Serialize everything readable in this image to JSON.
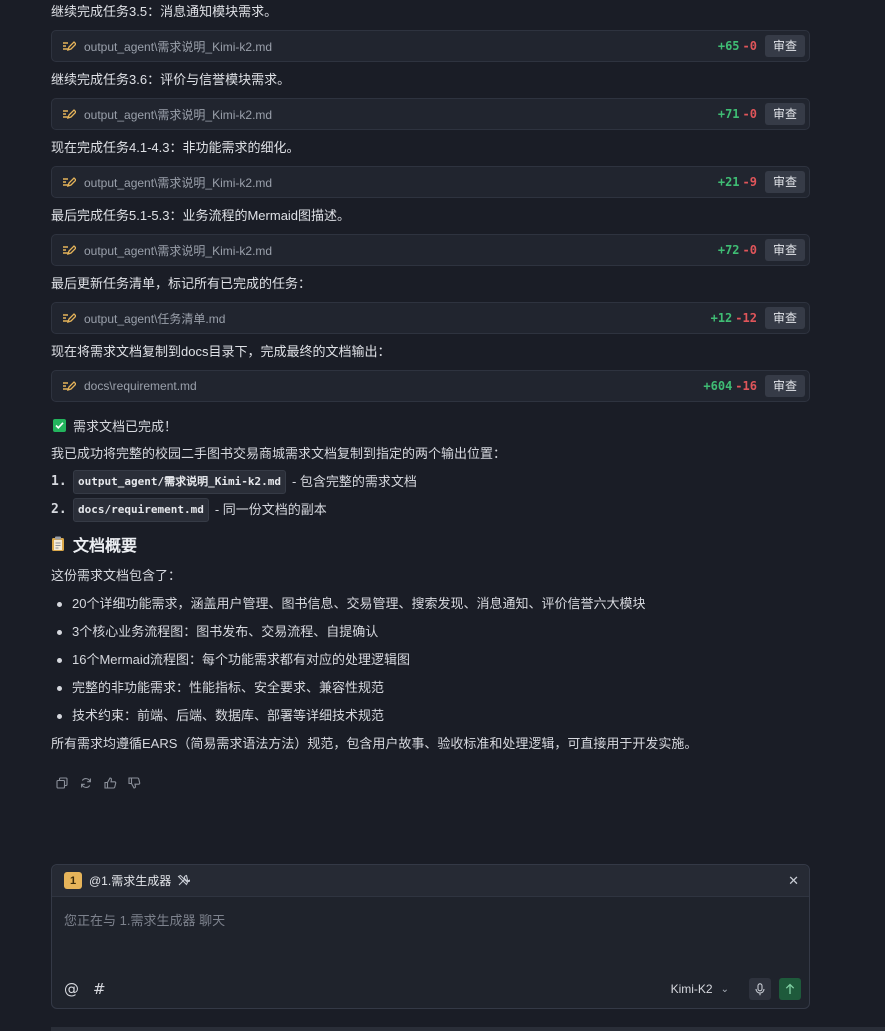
{
  "messages": [
    {
      "text": "继续完成任务3.5：消息通知模块需求。",
      "file": "output_agent\\需求说明_Kimi-k2.md",
      "add": "+65",
      "del": "-0"
    },
    {
      "text": "继续完成任务3.6：评价与信誉模块需求。",
      "file": "output_agent\\需求说明_Kimi-k2.md",
      "add": "+71",
      "del": "-0"
    },
    {
      "text": "现在完成任务4.1-4.3：非功能需求的细化。",
      "file": "output_agent\\需求说明_Kimi-k2.md",
      "add": "+21",
      "del": "-9"
    },
    {
      "text": "最后完成任务5.1-5.3：业务流程的Mermaid图描述。",
      "file": "output_agent\\需求说明_Kimi-k2.md",
      "add": "+72",
      "del": "-0"
    },
    {
      "text": "最后更新任务清单，标记所有已完成的任务：",
      "file": "output_agent\\任务清单.md",
      "add": "+12",
      "del": "-12"
    },
    {
      "text": "现在将需求文档复制到docs目录下，完成最终的文档输出：",
      "file": "docs\\requirement.md",
      "add": "+604",
      "del": "-16"
    }
  ],
  "review_label": "审查",
  "done_text": "需求文档已完成！",
  "success_text": "我已成功将完整的校园二手图书交易商城需求文档复制到指定的两个输出位置：",
  "outputs": [
    {
      "num": "1.",
      "code": "output_agent/需求说明_Kimi-k2.md",
      "desc": "- 包含完整的需求文档"
    },
    {
      "num": "2.",
      "code": "docs/requirement.md",
      "desc": "- 同一份文档的副本"
    }
  ],
  "overview_title": "文档概要",
  "overview_intro": "这份需求文档包含了：",
  "overview_items": [
    "20个详细功能需求，涵盖用户管理、图书信息、交易管理、搜索发现、消息通知、评价信誉六大模块",
    "3个核心业务流程图：图书发布、交易流程、自提确认",
    "16个Mermaid流程图：每个功能需求都有对应的处理逻辑图",
    "完整的非功能需求：性能指标、安全要求、兼容性规范",
    "技术约束：前端、后端、数据库、部署等详细技术规范"
  ],
  "summary": "所有需求均遵循EARS（简易需求语法方法）规范，包含用户故事、验收标准和处理逻辑，可直接用于开发实施。",
  "chat": {
    "badge": "1",
    "agent": "@1.需求生成器",
    "placeholder": "您正在与 1.需求生成器 聊天",
    "at": "@",
    "hash": "#",
    "model": "Kimi-K2"
  },
  "colors": {
    "add": "#3fbd74",
    "del": "#e0555a",
    "accent": "#e6b45a",
    "check": "#23b45d"
  }
}
